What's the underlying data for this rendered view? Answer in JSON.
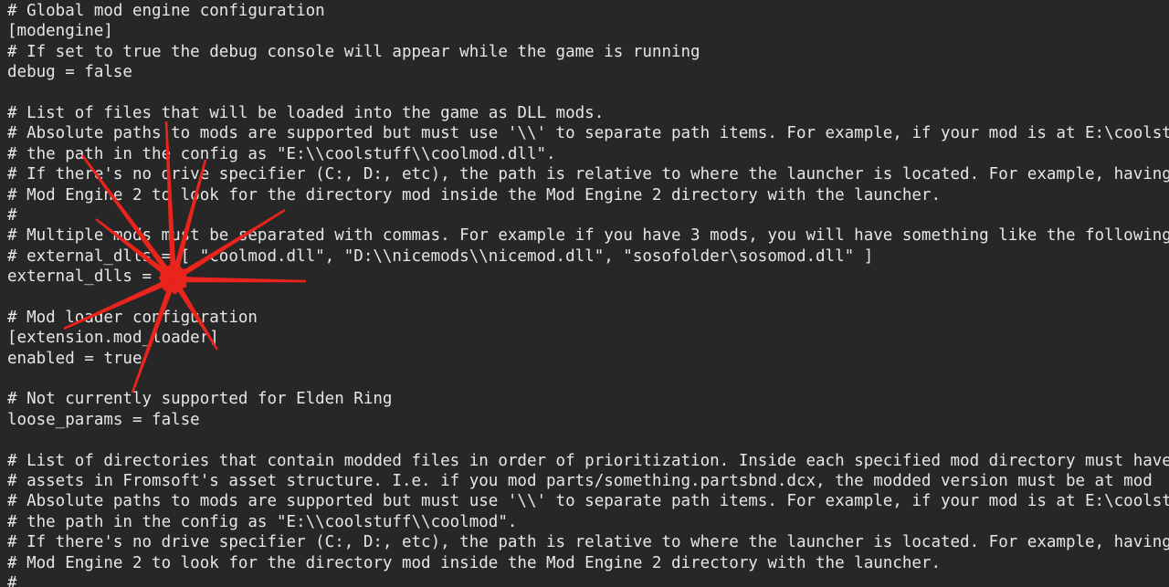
{
  "editor": {
    "lines": [
      "# Global mod engine configuration",
      "[modengine]",
      "# If set to true the debug console will appear while the game is running",
      "debug = false",
      "",
      "# List of files that will be loaded into the game as DLL mods.",
      "# Absolute paths to mods are supported but must use '\\\\' to separate path items. For example, if your mod is at E:\\coolstuff\\coolmod.dll, you must specify",
      "# the path in the config as \"E:\\\\coolstuff\\\\coolmod.dll\".",
      "# If there's no drive specifier (C:, D:, etc), the path is relative to where the launcher is located. For example, having \"mod\" as the path will cause",
      "# Mod Engine 2 to look for the directory mod inside the Mod Engine 2 directory with the launcher.",
      "#",
      "# Multiple mods must be separated with commas. For example if you have 3 mods, you will have something like the following:",
      "# external_dlls = [ \"coolmod.dll\", \"D:\\\\nicemods\\\\nicemod.dll\", \"sosofolder\\sosomod.dll\" ]",
      "external_dlls = []",
      "",
      "# Mod loader configuration",
      "[extension.mod_loader]",
      "enabled = true",
      "",
      "# Not currently supported for Elden Ring",
      "loose_params = false",
      "",
      "# List of directories that contain modded files in order of prioritization. Inside each specified mod directory must have",
      "# assets in Fromsoft's asset structure. I.e. if you mod parts/something.partsbnd.dcx, the modded version must be at mod",
      "# Absolute paths to mods are supported but must use '\\\\' to separate path items. For example, if your mod is at E:\\coolstuff\\coolmod, you must specify",
      "# the path in the config as \"E:\\\\coolstuff\\\\coolmod\".",
      "# If there's no drive specifier (C:, D:, etc), the path is relative to where the launcher is located. For example, having \"mod\" as the path will cause",
      "# Mod Engine 2 to look for the directory mod inside the Mod Engine 2 directory with the launcher.",
      "#"
    ]
  },
  "annotation": {
    "color": "#e8241c",
    "shape": "starburst-arrows",
    "target": "external_dlls = []"
  }
}
